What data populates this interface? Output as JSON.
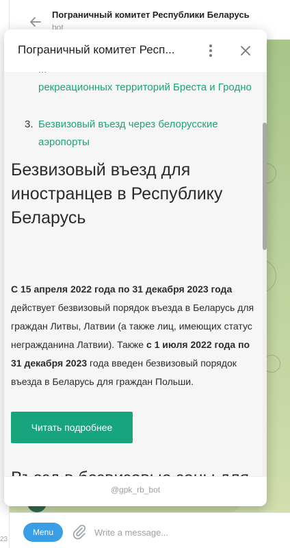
{
  "chat": {
    "title": "Пограничный комитет Республики Беларусь",
    "subtitle": "bot"
  },
  "popup": {
    "title": "Пограничный комитет Респ...",
    "footer_handle": "@gpk_rb_bot"
  },
  "content": {
    "link_cut": "...",
    "link_2": "рекреационных территорий Бреста и Гродно",
    "link_3_num": "3.",
    "link_3": "Безвизовый въезд через белорусские аэропорты",
    "heading": "Безвизовый въезд для иностранцев в Республику Беларусь",
    "para": {
      "b1": "С 15 апреля 2022 года по 31 декабря 2023 года",
      "t1": " действует безвизовый порядок въезда в Беларусь для граждан Литвы, Латвии (а также лиц, имеющих статус негражданина Латвии). Также ",
      "b2": "с 1 июля 2022 года по 31 декабря 2023",
      "t2": " года введен безвизовый порядок въезда в Беларусь для граждан Польши."
    },
    "read_more_label": "Читать подробнее",
    "next_heading": "Въезд в безвизовые зоны для"
  },
  "input": {
    "menu_label": "Menu",
    "placeholder": "Write a message..."
  },
  "side": {
    "bottom_num": "23"
  },
  "colors": {
    "accent": "#17a57e",
    "link": "#1aa37a",
    "menu_button": "#3a9ee4"
  }
}
